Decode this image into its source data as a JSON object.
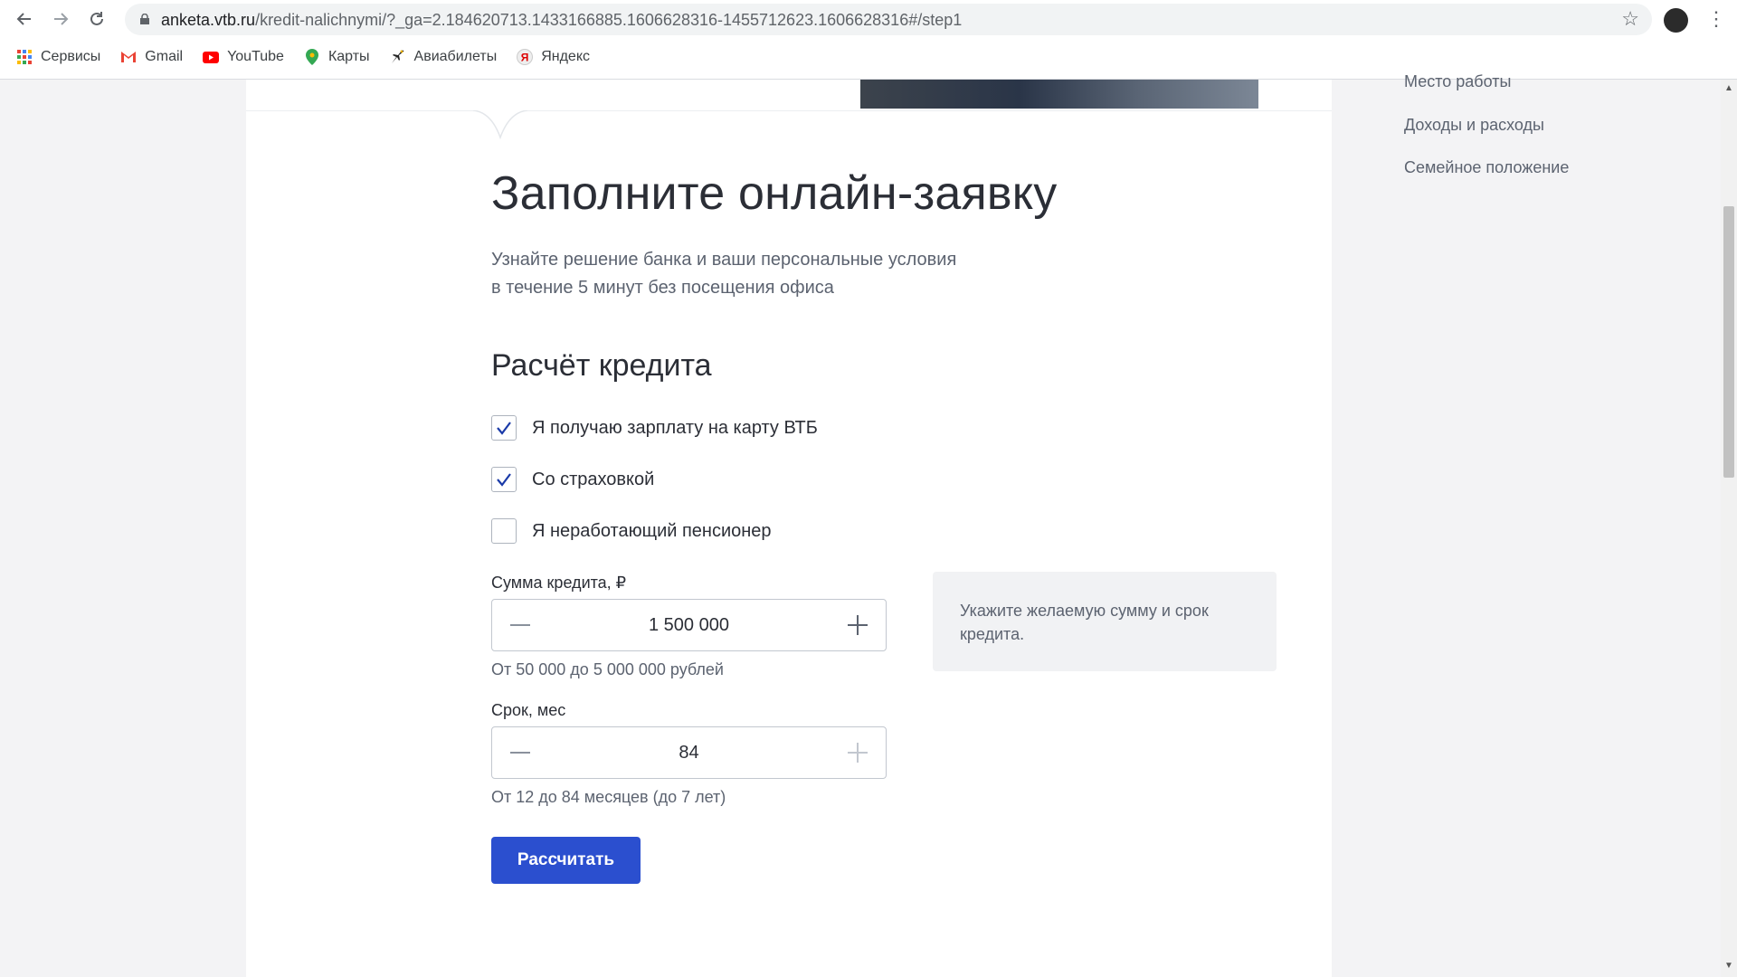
{
  "browser": {
    "url_host": "anketa.vtb.ru",
    "url_path": "/kredit-nalichnymi/?_ga=2.184620713.1433166885.1606628316-1455712623.1606628316#/step1",
    "bookmarks": [
      {
        "label": "Сервисы",
        "icon": "apps-grid-icon"
      },
      {
        "label": "Gmail",
        "icon": "gmail-icon"
      },
      {
        "label": "YouTube",
        "icon": "youtube-icon"
      },
      {
        "label": "Карты",
        "icon": "maps-pin-icon"
      },
      {
        "label": "Авиабилеты",
        "icon": "plane-icon"
      },
      {
        "label": "Яндекс",
        "icon": "yandex-icon"
      }
    ]
  },
  "sidebar": {
    "items": [
      "Место работы",
      "Доходы и расходы",
      "Семейное положение"
    ]
  },
  "form": {
    "title": "Заполните онлайн-заявку",
    "subtitle_line1": "Узнайте решение банка и ваши персональные условия",
    "subtitle_line2": "в течение 5 минут без посещения офиса",
    "section_title": "Расчёт кредита",
    "checkboxes": [
      {
        "label": "Я получаю зарплату на карту ВТБ",
        "checked": true
      },
      {
        "label": "Со страховкой",
        "checked": true
      },
      {
        "label": "Я неработающий пенсионер",
        "checked": false
      }
    ],
    "amount": {
      "label": "Сумма кредита, ₽",
      "value": "1 500 000",
      "hint": "От 50 000 до 5 000 000 рублей"
    },
    "term": {
      "label": "Срок, мес",
      "value": "84",
      "hint": "От 12 до 84 месяцев (до 7 лет)"
    },
    "tooltip": "Укажите желаемую сумму и срок кредита.",
    "submit_label": "Рассчитать"
  },
  "colors": {
    "accent": "#2b4fcf",
    "check": "#1a3aa8"
  }
}
